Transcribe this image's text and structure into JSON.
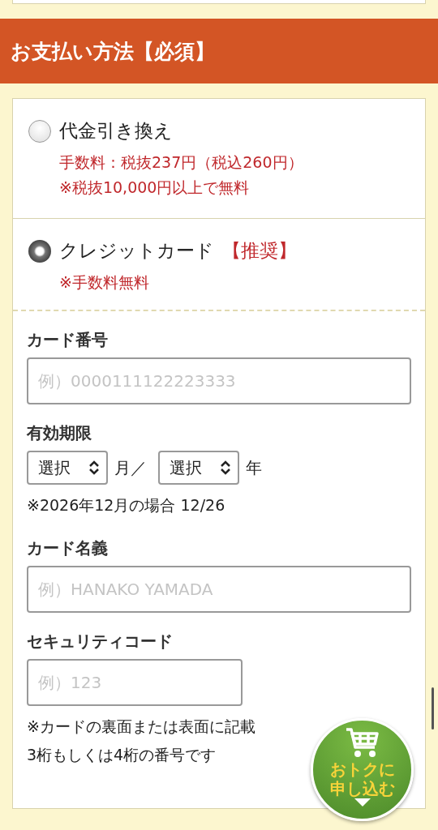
{
  "header": {
    "title": "お支払い方法【必須】"
  },
  "payment_options": [
    {
      "label": "代金引き換え",
      "selected": false,
      "notes": [
        "手数料：税抜237円（税込260円）",
        "※税抜10,000円以上で無料"
      ]
    },
    {
      "label": "クレジットカード",
      "tag": "【推奨】",
      "selected": true,
      "notes": [
        "※手数料無料"
      ]
    }
  ],
  "card_form": [
    {
      "kind": "input",
      "label": "カード番号",
      "placeholder": "例）0000111122223333"
    },
    {
      "kind": "expiry",
      "label": "有効期限",
      "selects": [
        {
          "value": "選択",
          "unit": "月／"
        },
        {
          "value": "選択",
          "unit": "年"
        }
      ],
      "notes": [
        "※2026年12月の場合 12/26"
      ]
    },
    {
      "kind": "input",
      "label": "カード名義",
      "placeholder": "例）HANAKO YAMADA"
    },
    {
      "kind": "short_input",
      "label": "セキュリティコード",
      "placeholder": "例）123",
      "notes": [
        "※カードの裏面または表面に記載",
        "3桁もしくは4桁の番号です"
      ]
    }
  ],
  "float_button": {
    "lines": [
      "おトクに",
      "申し込む"
    ]
  }
}
